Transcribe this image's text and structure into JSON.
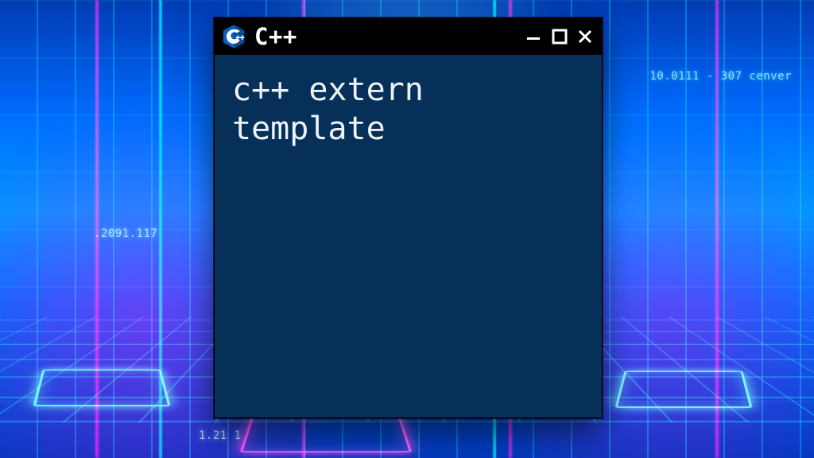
{
  "window": {
    "title": "C++",
    "logo_label": "C++",
    "content": "c++ extern template",
    "controls": {
      "minimize": "Minimize",
      "maximize": "Maximize",
      "close": "Close"
    }
  },
  "background": {
    "text_top_right": "10.0111 - 307  cenver",
    "text_mid_left": ".2091.117",
    "text_bottom": "1.21 1"
  },
  "colors": {
    "window_bg": "#0e2f4f",
    "titlebar_bg": "#000000",
    "text": "#eef3f6",
    "neon_cyan": "#38e8ff",
    "neon_pink": "#ff2ad1",
    "logo_blue": "#1d5fa8"
  }
}
